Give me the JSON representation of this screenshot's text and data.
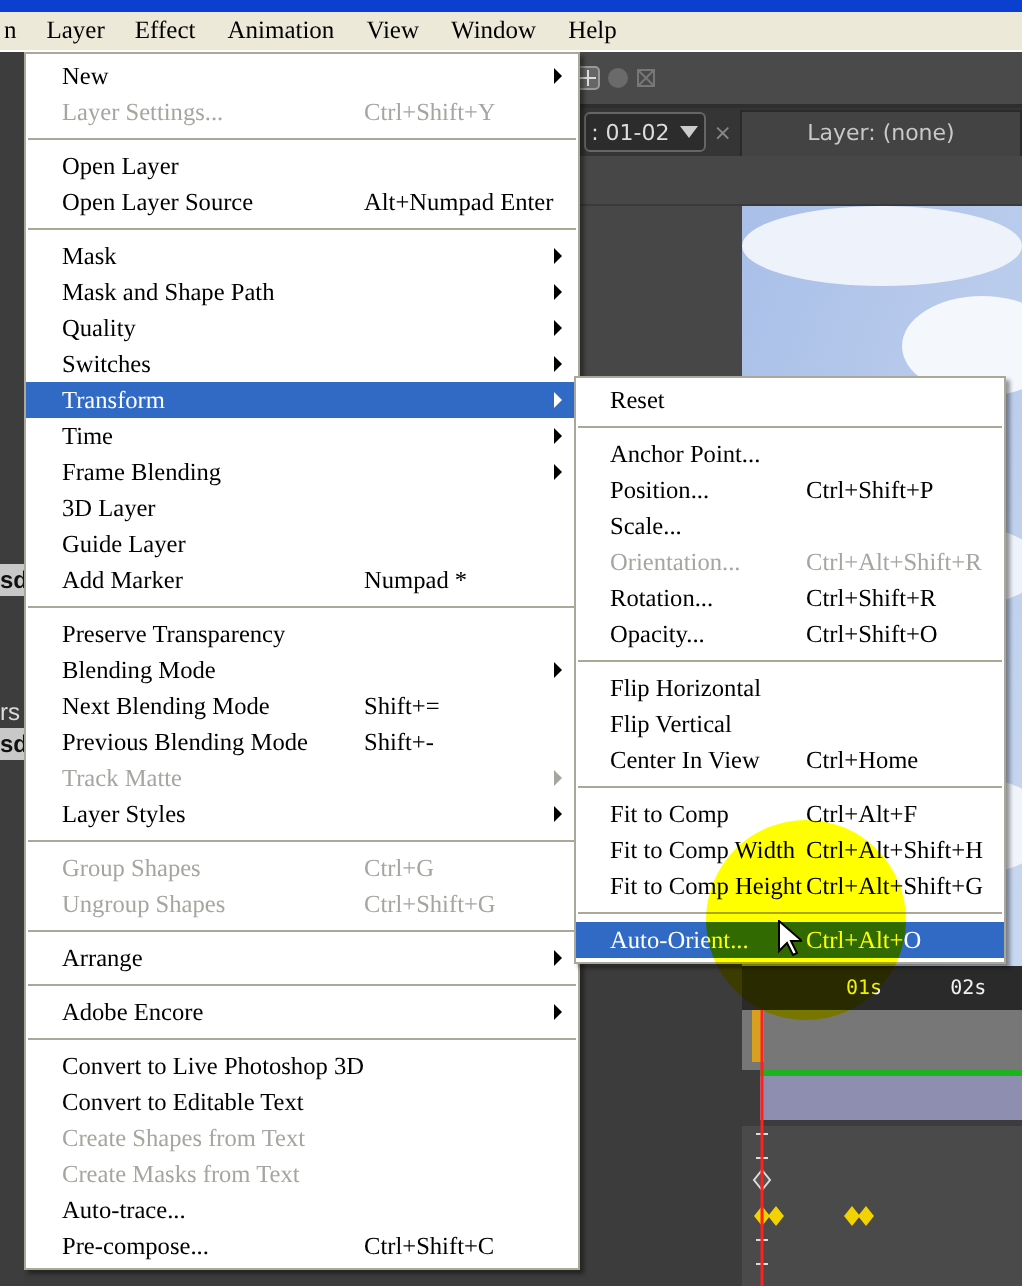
{
  "menubar": [
    {
      "label": "n",
      "selected": false
    },
    {
      "label": "Layer",
      "selected": true
    },
    {
      "label": "Effect",
      "selected": false
    },
    {
      "label": "Animation",
      "selected": false
    },
    {
      "label": "View",
      "selected": false
    },
    {
      "label": "Window",
      "selected": false
    },
    {
      "label": "Help",
      "selected": false
    }
  ],
  "background": {
    "left_panel_texts": [
      "sd",
      "rs",
      "sd"
    ],
    "composition_dropdown": ": 01-02",
    "close_tab": "×",
    "layer_tab": "Layer: (none)",
    "ruler_labels": [
      "01s",
      "02s"
    ]
  },
  "layer_menu": [
    {
      "kind": "item",
      "label": "New",
      "submenu": true,
      "disabled": false,
      "selected": false
    },
    {
      "kind": "item",
      "label": "Layer Settings...",
      "shortcut": "Ctrl+Shift+Y",
      "submenu": false,
      "disabled": true,
      "selected": false
    },
    {
      "kind": "separator"
    },
    {
      "kind": "item",
      "label": "Open Layer",
      "submenu": false,
      "disabled": false,
      "selected": false
    },
    {
      "kind": "item",
      "label": "Open Layer Source",
      "shortcut": "Alt+Numpad Enter",
      "submenu": false,
      "disabled": false,
      "selected": false
    },
    {
      "kind": "separator"
    },
    {
      "kind": "item",
      "label": "Mask",
      "submenu": true,
      "disabled": false,
      "selected": false
    },
    {
      "kind": "item",
      "label": "Mask and Shape Path",
      "submenu": true,
      "disabled": false,
      "selected": false
    },
    {
      "kind": "item",
      "label": "Quality",
      "submenu": true,
      "disabled": false,
      "selected": false
    },
    {
      "kind": "item",
      "label": "Switches",
      "submenu": true,
      "disabled": false,
      "selected": false
    },
    {
      "kind": "item",
      "label": "Transform",
      "submenu": true,
      "disabled": false,
      "selected": true
    },
    {
      "kind": "item",
      "label": "Time",
      "submenu": true,
      "disabled": false,
      "selected": false
    },
    {
      "kind": "item",
      "label": "Frame Blending",
      "submenu": true,
      "disabled": false,
      "selected": false
    },
    {
      "kind": "item",
      "label": "3D Layer",
      "submenu": false,
      "disabled": false,
      "selected": false
    },
    {
      "kind": "item",
      "label": "Guide Layer",
      "submenu": false,
      "disabled": false,
      "selected": false
    },
    {
      "kind": "item",
      "label": "Add Marker",
      "shortcut": "Numpad *",
      "submenu": false,
      "disabled": false,
      "selected": false
    },
    {
      "kind": "separator"
    },
    {
      "kind": "item",
      "label": "Preserve Transparency",
      "submenu": false,
      "disabled": false,
      "selected": false
    },
    {
      "kind": "item",
      "label": "Blending Mode",
      "submenu": true,
      "disabled": false,
      "selected": false
    },
    {
      "kind": "item",
      "label": "Next Blending Mode",
      "shortcut": "Shift+=",
      "submenu": false,
      "disabled": false,
      "selected": false
    },
    {
      "kind": "item",
      "label": "Previous Blending Mode",
      "shortcut": "Shift+-",
      "submenu": false,
      "disabled": false,
      "selected": false
    },
    {
      "kind": "item",
      "label": "Track Matte",
      "submenu": true,
      "disabled": true,
      "selected": false
    },
    {
      "kind": "item",
      "label": "Layer Styles",
      "submenu": true,
      "disabled": false,
      "selected": false
    },
    {
      "kind": "separator"
    },
    {
      "kind": "item",
      "label": "Group Shapes",
      "shortcut": "Ctrl+G",
      "submenu": false,
      "disabled": true,
      "selected": false
    },
    {
      "kind": "item",
      "label": "Ungroup Shapes",
      "shortcut": "Ctrl+Shift+G",
      "submenu": false,
      "disabled": true,
      "selected": false
    },
    {
      "kind": "separator"
    },
    {
      "kind": "item",
      "label": "Arrange",
      "submenu": true,
      "disabled": false,
      "selected": false
    },
    {
      "kind": "separator"
    },
    {
      "kind": "item",
      "label": "Adobe Encore",
      "submenu": true,
      "disabled": false,
      "selected": false
    },
    {
      "kind": "separator"
    },
    {
      "kind": "item",
      "label": "Convert to Live Photoshop 3D",
      "submenu": false,
      "disabled": false,
      "selected": false
    },
    {
      "kind": "item",
      "label": "Convert to Editable Text",
      "submenu": false,
      "disabled": false,
      "selected": false
    },
    {
      "kind": "item",
      "label": "Create Shapes from Text",
      "submenu": false,
      "disabled": true,
      "selected": false
    },
    {
      "kind": "item",
      "label": "Create Masks from Text",
      "submenu": false,
      "disabled": true,
      "selected": false
    },
    {
      "kind": "item",
      "label": "Auto-trace...",
      "submenu": false,
      "disabled": false,
      "selected": false
    },
    {
      "kind": "item",
      "label": "Pre-compose...",
      "shortcut": "Ctrl+Shift+C",
      "submenu": false,
      "disabled": false,
      "selected": false
    }
  ],
  "transform_submenu": [
    {
      "kind": "item",
      "label": "Reset",
      "disabled": false,
      "selected": false
    },
    {
      "kind": "separator"
    },
    {
      "kind": "item",
      "label": "Anchor Point...",
      "disabled": false,
      "selected": false
    },
    {
      "kind": "item",
      "label": "Position...",
      "shortcut": "Ctrl+Shift+P",
      "disabled": false,
      "selected": false
    },
    {
      "kind": "item",
      "label": "Scale...",
      "disabled": false,
      "selected": false
    },
    {
      "kind": "item",
      "label": "Orientation...",
      "shortcut": "Ctrl+Alt+Shift+R",
      "disabled": true,
      "selected": false
    },
    {
      "kind": "item",
      "label": "Rotation...",
      "shortcut": "Ctrl+Shift+R",
      "disabled": false,
      "selected": false
    },
    {
      "kind": "item",
      "label": "Opacity...",
      "shortcut": "Ctrl+Shift+O",
      "disabled": false,
      "selected": false
    },
    {
      "kind": "separator"
    },
    {
      "kind": "item",
      "label": "Flip Horizontal",
      "disabled": false,
      "selected": false
    },
    {
      "kind": "item",
      "label": "Flip Vertical",
      "disabled": false,
      "selected": false
    },
    {
      "kind": "item",
      "label": "Center In View",
      "shortcut": "Ctrl+Home",
      "disabled": false,
      "selected": false
    },
    {
      "kind": "separator"
    },
    {
      "kind": "item",
      "label": "Fit to Comp",
      "shortcut": "Ctrl+Alt+F",
      "disabled": false,
      "selected": false
    },
    {
      "kind": "item",
      "label": "Fit to Comp Width",
      "shortcut": "Ctrl+Alt+Shift+H",
      "disabled": false,
      "selected": false
    },
    {
      "kind": "item",
      "label": "Fit to Comp Height",
      "shortcut": "Ctrl+Alt+Shift+G",
      "disabled": false,
      "selected": false
    },
    {
      "kind": "separator"
    },
    {
      "kind": "item",
      "label": "Auto-Orient...",
      "shortcut": "Ctrl+Alt+O",
      "disabled": false,
      "selected": true
    }
  ]
}
